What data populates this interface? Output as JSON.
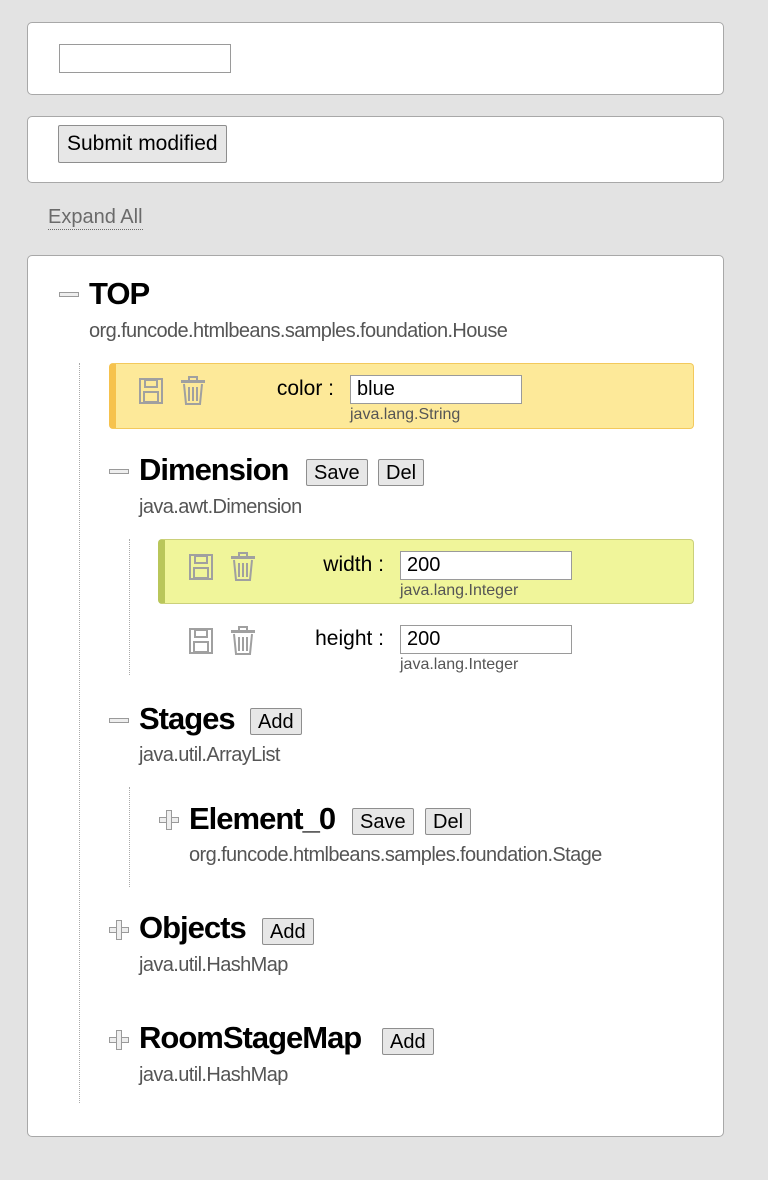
{
  "top_input": {
    "value": ""
  },
  "submit": {
    "label": "Submit modified"
  },
  "expand_all": {
    "label": "Expand All"
  },
  "tree": {
    "root": {
      "title": "TOP",
      "type": "org.funcode.htmlbeans.samples.foundation.House"
    },
    "color_field": {
      "label": "color :",
      "value": "blue",
      "type": "java.lang.String"
    },
    "dimension": {
      "title": "Dimension",
      "type": "java.awt.Dimension",
      "save_label": "Save",
      "del_label": "Del",
      "width_field": {
        "label": "width :",
        "value": "200",
        "type": "java.lang.Integer"
      },
      "height_field": {
        "label": "height :",
        "value": "200",
        "type": "java.lang.Integer"
      }
    },
    "stages": {
      "title": "Stages",
      "type": "java.util.ArrayList",
      "add_label": "Add",
      "element_0": {
        "title": "Element_0",
        "type": "org.funcode.htmlbeans.samples.foundation.Stage",
        "save_label": "Save",
        "del_label": "Del"
      }
    },
    "objects": {
      "title": "Objects",
      "type": "java.util.HashMap",
      "add_label": "Add"
    },
    "room_stage_map": {
      "title": "RoomStageMap",
      "type": "java.util.HashMap",
      "add_label": "Add"
    }
  },
  "icons": {
    "save": "floppy-disk-icon",
    "delete": "trash-icon",
    "collapse": "minus-icon",
    "expand": "plus-icon"
  },
  "colors": {
    "background": "#e3e3e3",
    "highlight_yellow": "#fde999",
    "highlight_green": "#f0f59a"
  }
}
